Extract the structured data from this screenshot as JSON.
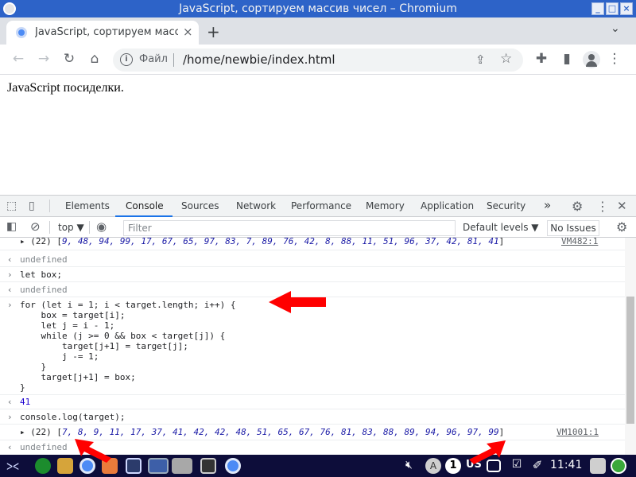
{
  "window": {
    "title": "JavaScript, сортируем массив чисел – Chromium",
    "buttons": [
      "_",
      "□",
      "×"
    ]
  },
  "tab": {
    "label": "JavaScript, сортируем масс",
    "close": "×",
    "new_tab": "+"
  },
  "toolbar": {
    "back": "←",
    "forward": "→",
    "reload": "↻",
    "home": "⌂",
    "scheme": "Файл",
    "url": "/home/newbie/index.html",
    "share": "⇪",
    "bookmark": "☆",
    "extensions": "✚",
    "sidepanel": "▮",
    "menu": "⋮"
  },
  "page": {
    "text": "JavaScript посиделки."
  },
  "devtools": {
    "tabs": [
      "Elements",
      "Console",
      "Sources",
      "Network",
      "Performance",
      "Memory",
      "Application",
      "Security"
    ],
    "active_tab": "Console",
    "more": "»",
    "settings": "⚙",
    "menu": "⋮",
    "close": "✕",
    "console_bar": {
      "context": "top ▼",
      "filter_placeholder": "Filter",
      "levels": "Default levels ▼",
      "issues": "No Issues"
    }
  },
  "console": {
    "line1_prefix": "▸ (22) [",
    "line1_values": "9, 48, 94, 99, 17, 67, 65, 97, 83, 7, 89, 76, 42, 8, 88, 11, 51, 96, 37, 42, 81, 41",
    "line1_suffix": "]",
    "line1_link": "VM482:1",
    "undefined1": "undefined",
    "cmd_let": "let box;",
    "undefined2": "undefined",
    "code": [
      "for (let i = 1; i < target.length; i++) {",
      "    box = target[i];",
      "    let j = i - 1;",
      "    while (j >= 0 && box < target[j]) {",
      "        target[j+1] = target[j];",
      "        j -= 1;",
      "    }",
      "    target[j+1] = box;",
      "}"
    ],
    "return_41": "41",
    "cmd_log": "console.log(target);",
    "result_prefix": "▸ (22) [",
    "result_values": "7, 8, 9, 11, 17, 37, 41, 42, 42, 48, 51, 65, 67, 76, 81, 83, 88, 89, 94, 96, 97, 99",
    "result_suffix": "]",
    "result_link": "VM1001:1",
    "undefined3": "undefined"
  },
  "taskbar": {
    "keyboard": "US",
    "clock": "11:41",
    "badge": "1"
  },
  "colors": {
    "titlebar": "#2d63c8",
    "taskbar": "#0d0d3a",
    "arrow": "#ff0000",
    "devtools_accent": "#1a73e8"
  }
}
